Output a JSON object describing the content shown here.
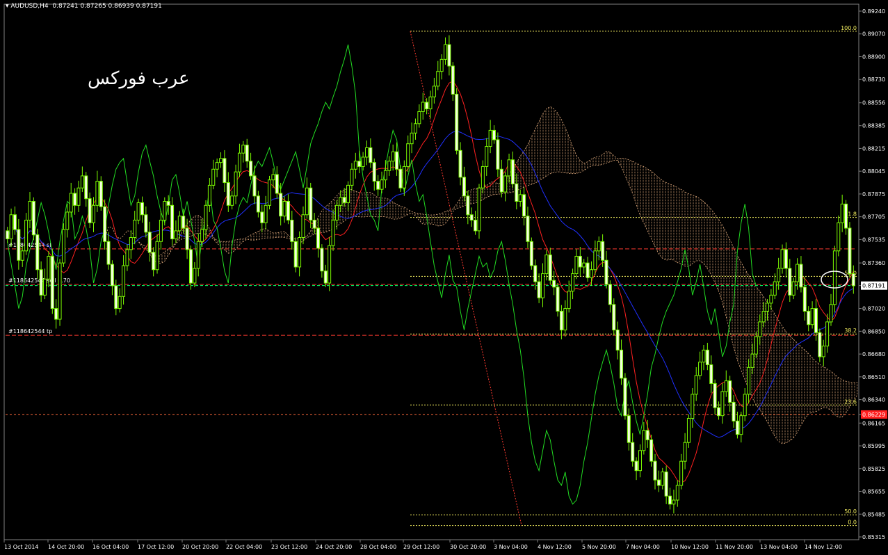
{
  "header": {
    "symbol": "AUDUSD,H4",
    "ohlc": "0.87241 0.87265 0.86939 0.87191"
  },
  "watermark": "عرب فوركس",
  "colors": {
    "background": "#000000",
    "candle": "#7CFC00",
    "chikou": "#22dd22",
    "tenkan": "#ff2020",
    "kijun": "#2030ff",
    "cloud": "#e8b080",
    "fib": "#f5f060",
    "order": "#ff3b30",
    "bid": "#00ff66",
    "price_label_bg": "#ffffff",
    "alert_label_bg": "#ff2020"
  },
  "chart_data": {
    "type": "candlestick",
    "ylim": [
      0.85315,
      0.8924
    ],
    "y_ticks": [
      "0.89240",
      "0.89070",
      "0.88900",
      "0.88730",
      "0.88556",
      "0.88385",
      "0.88215",
      "0.88045",
      "0.87875",
      "0.87705",
      "0.87535",
      "0.87360",
      "0.87191",
      "0.87020",
      "0.86850",
      "0.86680",
      "0.86510",
      "0.86340",
      "0.86229",
      "0.86165",
      "0.85995",
      "0.85825",
      "0.85655",
      "0.85485",
      "0.85315"
    ],
    "x_ticks": [
      "13 Oct 2014",
      "14 Oct 20:00",
      "16 Oct 04:00",
      "17 Oct 12:00",
      "20 Oct 20:00",
      "22 Oct 04:00",
      "23 Oct 12:00",
      "24 Oct 20:00",
      "28 Oct 04:00",
      "29 Oct 12:00",
      "30 Oct 20:00",
      "3 Nov 04:00",
      "4 Nov 12:00",
      "5 Nov 20:00",
      "7 Nov 04:00",
      "10 Nov 12:00",
      "11 Nov 20:00",
      "13 Nov 04:00",
      "14 Nov 12:00"
    ],
    "current_price": "0.87191",
    "alert_price": "0.86229",
    "fib_levels": [
      {
        "label": "100.0",
        "price": 0.8909
      },
      {
        "label": "61.8",
        "price": 0.877
      },
      {
        "label": "50.0",
        "price": 0.8726
      },
      {
        "label": "38.2",
        "price": 0.8683
      },
      {
        "label": "23.6",
        "price": 0.863
      },
      {
        "label": "50.0",
        "price": 0.8548
      },
      {
        "label": "0.0",
        "price": 0.854
      }
    ],
    "orders": [
      {
        "label": "#118642544 sl",
        "price": 0.87465
      },
      {
        "label": "#118642544 sell 0.70",
        "price": 0.872
      },
      {
        "label": "#118642544 tp",
        "price": 0.8682
      }
    ],
    "closes": [
      0.8754,
      0.8772,
      0.8761,
      0.8738,
      0.8745,
      0.8768,
      0.8782,
      0.8757,
      0.8731,
      0.8712,
      0.8724,
      0.8741,
      0.8702,
      0.8694,
      0.8736,
      0.8761,
      0.8774,
      0.8788,
      0.8779,
      0.8792,
      0.8801,
      0.8784,
      0.8766,
      0.8779,
      0.8797,
      0.8778,
      0.8752,
      0.8735,
      0.8719,
      0.8702,
      0.8711,
      0.8734,
      0.8746,
      0.8755,
      0.8768,
      0.8781,
      0.8772,
      0.8759,
      0.8744,
      0.8731,
      0.8752,
      0.8768,
      0.8782,
      0.8779,
      0.8754,
      0.876,
      0.8771,
      0.8762,
      0.8746,
      0.8721,
      0.8732,
      0.8752,
      0.8761,
      0.8779,
      0.8794,
      0.8806,
      0.8811,
      0.8814,
      0.8796,
      0.8779,
      0.8786,
      0.8804,
      0.8818,
      0.8824,
      0.8812,
      0.8801,
      0.8786,
      0.8774,
      0.8766,
      0.8779,
      0.8798,
      0.8802,
      0.8788,
      0.8771,
      0.8782,
      0.8768,
      0.8752,
      0.8733,
      0.8755,
      0.8772,
      0.8792,
      0.8768,
      0.8762,
      0.8747,
      0.873,
      0.8721,
      0.8749,
      0.8768,
      0.8779,
      0.8785,
      0.8781,
      0.8794,
      0.8806,
      0.8812,
      0.8808,
      0.8815,
      0.8822,
      0.8811,
      0.8797,
      0.8791,
      0.8798,
      0.8805,
      0.8812,
      0.8819,
      0.8806,
      0.8792,
      0.8808,
      0.8825,
      0.8833,
      0.884,
      0.8849,
      0.8856,
      0.8851,
      0.886,
      0.8868,
      0.8879,
      0.8888,
      0.8899,
      0.8883,
      0.8862,
      0.882,
      0.88,
      0.8786,
      0.8772,
      0.8768,
      0.876,
      0.8792,
      0.8808,
      0.8823,
      0.8835,
      0.8828,
      0.8806,
      0.8789,
      0.8801,
      0.8813,
      0.8795,
      0.8782,
      0.8787,
      0.8771,
      0.8752,
      0.8734,
      0.8722,
      0.871,
      0.8728,
      0.8742,
      0.8723,
      0.8718,
      0.87,
      0.8686,
      0.8702,
      0.8715,
      0.8728,
      0.8741,
      0.8733,
      0.8736,
      0.8725,
      0.8731,
      0.8745,
      0.8752,
      0.8738,
      0.872,
      0.8705,
      0.8686,
      0.8671,
      0.865,
      0.8622,
      0.8602,
      0.8588,
      0.8581,
      0.8596,
      0.8611,
      0.8604,
      0.8588,
      0.8574,
      0.857,
      0.858,
      0.8562,
      0.8556,
      0.8559,
      0.857,
      0.8588,
      0.8602,
      0.862,
      0.8638,
      0.8652,
      0.8662,
      0.8671,
      0.866,
      0.8646,
      0.8628,
      0.8622,
      0.864,
      0.8648,
      0.8632,
      0.8618,
      0.8608,
      0.8622,
      0.8638,
      0.8658,
      0.8668,
      0.8681,
      0.8692,
      0.87,
      0.8706,
      0.8712,
      0.8722,
      0.8732,
      0.8746,
      0.8732,
      0.8712,
      0.8722,
      0.8735,
      0.8718,
      0.87,
      0.869,
      0.8702,
      0.8684,
      0.8666,
      0.8674,
      0.8692,
      0.8705,
      0.8745,
      0.8766,
      0.878,
      0.8762,
      0.8728,
      0.8719
    ]
  }
}
